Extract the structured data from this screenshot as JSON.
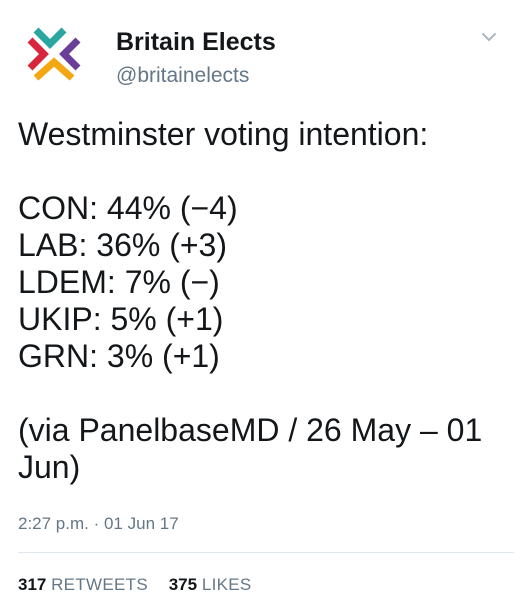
{
  "colors": {
    "text": "#14171a",
    "secondary": "#657786",
    "divider": "#e1e8ed",
    "logo_red": "#d7263d",
    "logo_teal": "#2aa6a0",
    "logo_purple": "#6b3f98",
    "logo_orange": "#f3a712"
  },
  "account": {
    "name": "Britain Elects",
    "handle": "@britainelects",
    "avatar_icon": "britain-elects-logo-icon"
  },
  "menu": {
    "icon": "chevron-down-icon"
  },
  "tweet": {
    "headline": "Westminster voting intention:",
    "lines": [
      "CON: 44% (−4)",
      "LAB: 36% (+3)",
      "LDEM: 7% (−)",
      "UKIP: 5% (+1)",
      "GRN: 3% (+1)"
    ],
    "source": "(via PanelbaseMD / 26 May – 01 Jun)"
  },
  "meta": {
    "timestamp": "2:27 p.m. · 01 Jun 17"
  },
  "stats": {
    "retweets_count": "317",
    "retweets_label": "RETWEETS",
    "likes_count": "375",
    "likes_label": "LIKES"
  }
}
